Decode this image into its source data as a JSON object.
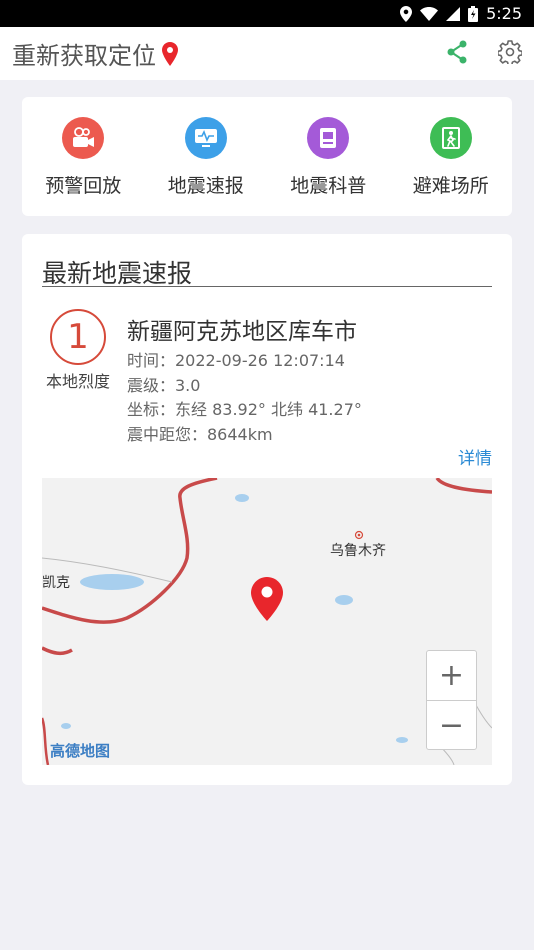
{
  "status_bar": {
    "time": "5:25"
  },
  "app_bar": {
    "title": "重新获取定位"
  },
  "nav": {
    "items": [
      {
        "label": "预警回放",
        "icon": "video-camera-icon",
        "color": "#ec5a4f"
      },
      {
        "label": "地震速报",
        "icon": "monitor-wave-icon",
        "color": "#3da0e8"
      },
      {
        "label": "地震科普",
        "icon": "book-icon",
        "color": "#a45ad8"
      },
      {
        "label": "避难场所",
        "icon": "exit-door-icon",
        "color": "#3ebd55"
      }
    ]
  },
  "quake": {
    "header": "最新地震速报",
    "intensity": "1",
    "intensity_label": "本地烈度",
    "location": "新疆阿克苏地区库车市",
    "time_line": "时间：2022-09-26 12:07:14",
    "magnitude_line": "震级：3.0",
    "coord_line": "坐标：东经 83.92° 北纬 41.27°",
    "distance_line": "震中距您：8644km",
    "detail_link": "详情"
  },
  "map": {
    "city_label": "乌鲁木齐",
    "edge_label": "凯克",
    "zoom_in": "+",
    "zoom_out": "−",
    "logo": "高德地图"
  },
  "colors": {
    "accent_red": "#d64a3a",
    "link_blue": "#2a8ad4",
    "share_green": "#3bb36a"
  }
}
